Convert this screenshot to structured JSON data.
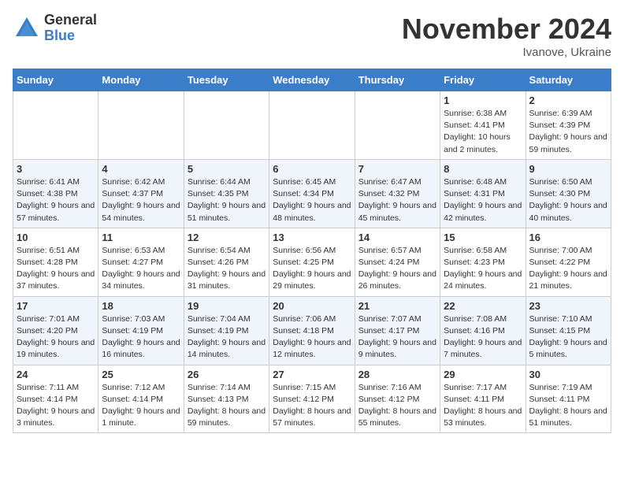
{
  "logo": {
    "general": "General",
    "blue": "Blue"
  },
  "title": {
    "month": "November 2024",
    "location": "Ivanove, Ukraine"
  },
  "weekdays": [
    "Sunday",
    "Monday",
    "Tuesday",
    "Wednesday",
    "Thursday",
    "Friday",
    "Saturday"
  ],
  "weeks": [
    [
      {
        "day": "",
        "info": ""
      },
      {
        "day": "",
        "info": ""
      },
      {
        "day": "",
        "info": ""
      },
      {
        "day": "",
        "info": ""
      },
      {
        "day": "",
        "info": ""
      },
      {
        "day": "1",
        "info": "Sunrise: 6:38 AM\nSunset: 4:41 PM\nDaylight: 10 hours and 2 minutes."
      },
      {
        "day": "2",
        "info": "Sunrise: 6:39 AM\nSunset: 4:39 PM\nDaylight: 9 hours and 59 minutes."
      }
    ],
    [
      {
        "day": "3",
        "info": "Sunrise: 6:41 AM\nSunset: 4:38 PM\nDaylight: 9 hours and 57 minutes."
      },
      {
        "day": "4",
        "info": "Sunrise: 6:42 AM\nSunset: 4:37 PM\nDaylight: 9 hours and 54 minutes."
      },
      {
        "day": "5",
        "info": "Sunrise: 6:44 AM\nSunset: 4:35 PM\nDaylight: 9 hours and 51 minutes."
      },
      {
        "day": "6",
        "info": "Sunrise: 6:45 AM\nSunset: 4:34 PM\nDaylight: 9 hours and 48 minutes."
      },
      {
        "day": "7",
        "info": "Sunrise: 6:47 AM\nSunset: 4:32 PM\nDaylight: 9 hours and 45 minutes."
      },
      {
        "day": "8",
        "info": "Sunrise: 6:48 AM\nSunset: 4:31 PM\nDaylight: 9 hours and 42 minutes."
      },
      {
        "day": "9",
        "info": "Sunrise: 6:50 AM\nSunset: 4:30 PM\nDaylight: 9 hours and 40 minutes."
      }
    ],
    [
      {
        "day": "10",
        "info": "Sunrise: 6:51 AM\nSunset: 4:28 PM\nDaylight: 9 hours and 37 minutes."
      },
      {
        "day": "11",
        "info": "Sunrise: 6:53 AM\nSunset: 4:27 PM\nDaylight: 9 hours and 34 minutes."
      },
      {
        "day": "12",
        "info": "Sunrise: 6:54 AM\nSunset: 4:26 PM\nDaylight: 9 hours and 31 minutes."
      },
      {
        "day": "13",
        "info": "Sunrise: 6:56 AM\nSunset: 4:25 PM\nDaylight: 9 hours and 29 minutes."
      },
      {
        "day": "14",
        "info": "Sunrise: 6:57 AM\nSunset: 4:24 PM\nDaylight: 9 hours and 26 minutes."
      },
      {
        "day": "15",
        "info": "Sunrise: 6:58 AM\nSunset: 4:23 PM\nDaylight: 9 hours and 24 minutes."
      },
      {
        "day": "16",
        "info": "Sunrise: 7:00 AM\nSunset: 4:22 PM\nDaylight: 9 hours and 21 minutes."
      }
    ],
    [
      {
        "day": "17",
        "info": "Sunrise: 7:01 AM\nSunset: 4:20 PM\nDaylight: 9 hours and 19 minutes."
      },
      {
        "day": "18",
        "info": "Sunrise: 7:03 AM\nSunset: 4:19 PM\nDaylight: 9 hours and 16 minutes."
      },
      {
        "day": "19",
        "info": "Sunrise: 7:04 AM\nSunset: 4:19 PM\nDaylight: 9 hours and 14 minutes."
      },
      {
        "day": "20",
        "info": "Sunrise: 7:06 AM\nSunset: 4:18 PM\nDaylight: 9 hours and 12 minutes."
      },
      {
        "day": "21",
        "info": "Sunrise: 7:07 AM\nSunset: 4:17 PM\nDaylight: 9 hours and 9 minutes."
      },
      {
        "day": "22",
        "info": "Sunrise: 7:08 AM\nSunset: 4:16 PM\nDaylight: 9 hours and 7 minutes."
      },
      {
        "day": "23",
        "info": "Sunrise: 7:10 AM\nSunset: 4:15 PM\nDaylight: 9 hours and 5 minutes."
      }
    ],
    [
      {
        "day": "24",
        "info": "Sunrise: 7:11 AM\nSunset: 4:14 PM\nDaylight: 9 hours and 3 minutes."
      },
      {
        "day": "25",
        "info": "Sunrise: 7:12 AM\nSunset: 4:14 PM\nDaylight: 9 hours and 1 minute."
      },
      {
        "day": "26",
        "info": "Sunrise: 7:14 AM\nSunset: 4:13 PM\nDaylight: 8 hours and 59 minutes."
      },
      {
        "day": "27",
        "info": "Sunrise: 7:15 AM\nSunset: 4:12 PM\nDaylight: 8 hours and 57 minutes."
      },
      {
        "day": "28",
        "info": "Sunrise: 7:16 AM\nSunset: 4:12 PM\nDaylight: 8 hours and 55 minutes."
      },
      {
        "day": "29",
        "info": "Sunrise: 7:17 AM\nSunset: 4:11 PM\nDaylight: 8 hours and 53 minutes."
      },
      {
        "day": "30",
        "info": "Sunrise: 7:19 AM\nSunset: 4:11 PM\nDaylight: 8 hours and 51 minutes."
      }
    ]
  ]
}
